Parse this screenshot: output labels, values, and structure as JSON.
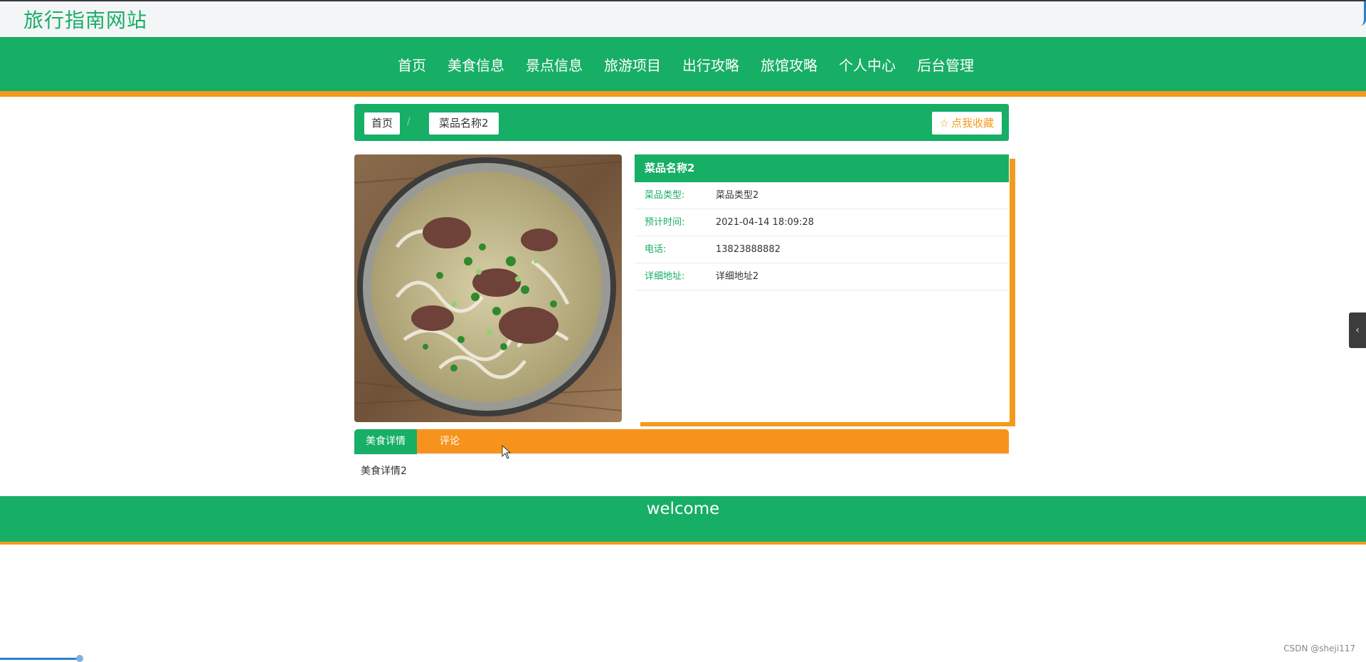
{
  "site": {
    "title": "旅行指南网站"
  },
  "nav": {
    "items": [
      {
        "label": "首页"
      },
      {
        "label": "美食信息"
      },
      {
        "label": "景点信息"
      },
      {
        "label": "旅游项目"
      },
      {
        "label": "出行攻略"
      },
      {
        "label": "旅馆攻略"
      },
      {
        "label": "个人中心"
      },
      {
        "label": "后台管理"
      }
    ]
  },
  "breadcrumb": {
    "home": "首页",
    "separator": "/",
    "current": "菜品名称2",
    "favorite_button": "点我收藏",
    "favorite_icon": "star-outline-icon"
  },
  "detail": {
    "name": "菜品名称2",
    "fields": [
      {
        "label": "菜品类型:",
        "value": "菜品类型2"
      },
      {
        "label": "预计时间:",
        "value": "2021-04-14 18:09:28"
      },
      {
        "label": "电话:",
        "value": "13823888882"
      },
      {
        "label": "详细地址:",
        "value": "详细地址2"
      }
    ]
  },
  "tabs": {
    "active": "美食详情",
    "comment": "评论"
  },
  "content": {
    "detail_text": "美食详情2"
  },
  "footer": {
    "text": "welcome"
  },
  "watermark": "CSDN @sheji117",
  "colors": {
    "primary_green": "#17ae66",
    "accent_orange": "#f39a1c"
  }
}
